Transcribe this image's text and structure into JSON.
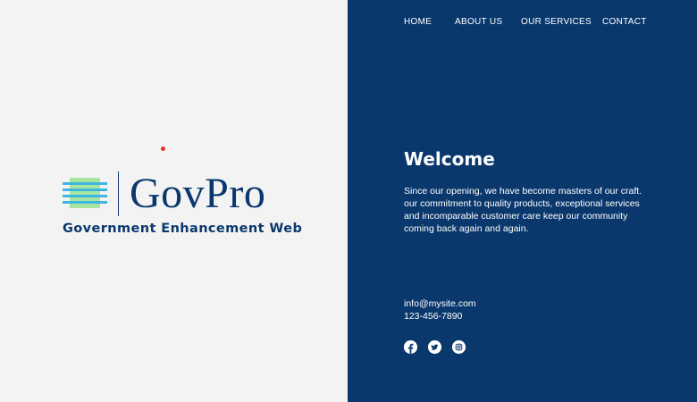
{
  "brand": {
    "name": "GovPro",
    "tagline": "Government Enhancement Web",
    "logo_icon": "stacked-lines-logo-icon",
    "colors": {
      "primary": "#0a386d",
      "logo_green": "#a8e6a0",
      "logo_blue": "#3fb6e0",
      "dot": "#e0332e"
    }
  },
  "nav": {
    "items": [
      {
        "label": "HOME"
      },
      {
        "label": "ABOUT US"
      },
      {
        "label": "OUR SERVICES"
      },
      {
        "label": "CONTACT"
      }
    ]
  },
  "welcome": {
    "title": "Welcome",
    "body": "Since our opening, we have become masters of our craft. our commitment to quality products, exceptional services and incomparable customer care keep our community coming back again and again."
  },
  "contact": {
    "email": "info@mysite.com",
    "phone": "123-456-7890"
  },
  "social": {
    "icons": [
      "facebook-icon",
      "twitter-icon",
      "instagram-icon"
    ]
  }
}
